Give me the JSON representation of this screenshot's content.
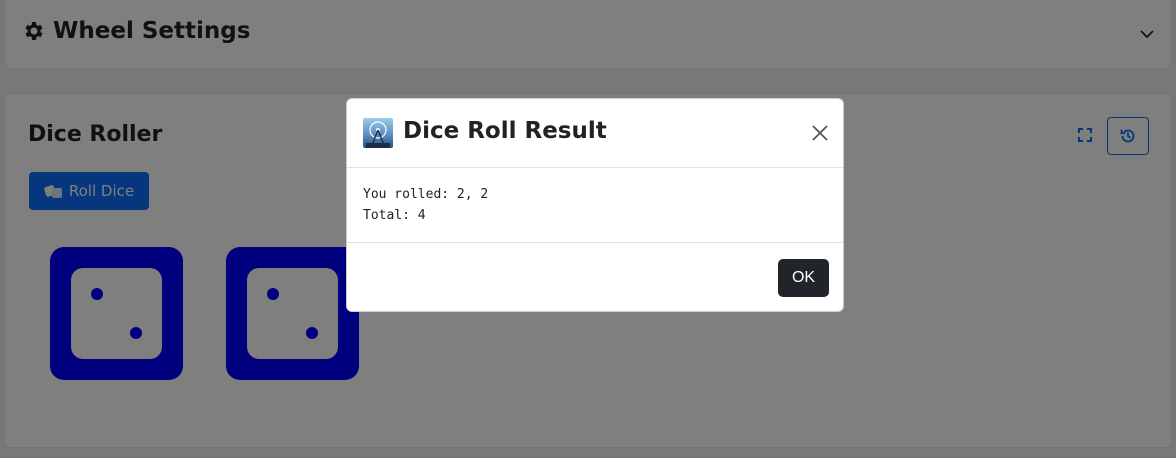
{
  "settings_card": {
    "title": "Wheel Settings",
    "icon": "gear-icon",
    "toggle_icon": "chevron-down-icon"
  },
  "dice_card": {
    "title": "Dice Roller",
    "roll_button_label": "Roll Dice",
    "roll_button_icon": "dice-icon",
    "fullscreen_icon": "fullscreen-icon",
    "history_icon": "history-icon",
    "dice": [
      {
        "value": 2
      },
      {
        "value": 2
      }
    ],
    "dice_color": "#0000ff"
  },
  "modal": {
    "title": "Dice Roll Result",
    "result_line": "You rolled: 2, 2",
    "total_line": "Total: 4",
    "ok_label": "OK",
    "close_icon": "close-icon"
  },
  "colors": {
    "primary": "#0d6efd",
    "dark_button": "#212529",
    "die": "#0000ff"
  }
}
